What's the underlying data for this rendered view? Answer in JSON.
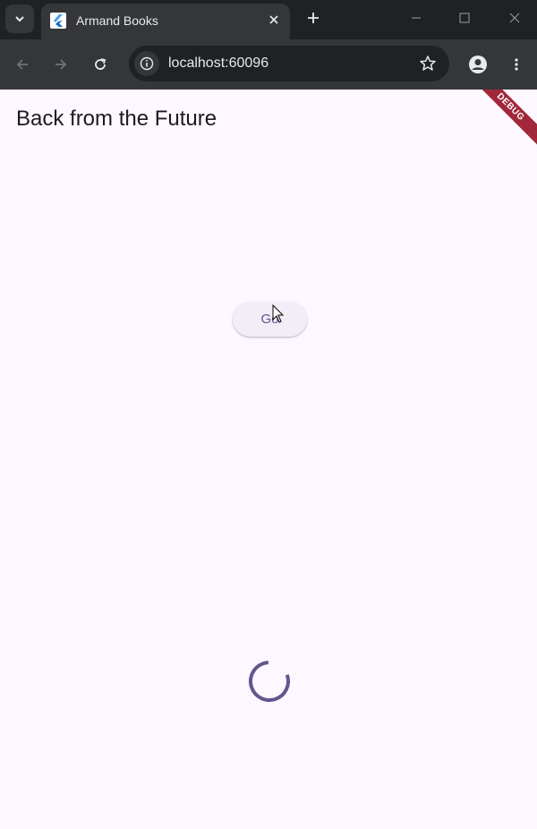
{
  "browser": {
    "tab_title": "Armand Books",
    "url": "localhost:60096"
  },
  "app": {
    "title": "Back from the Future",
    "go_button_label": "Go",
    "debug_banner": "DEBUG",
    "accent_color": "#65558f",
    "background_color": "#fdf7ff"
  }
}
